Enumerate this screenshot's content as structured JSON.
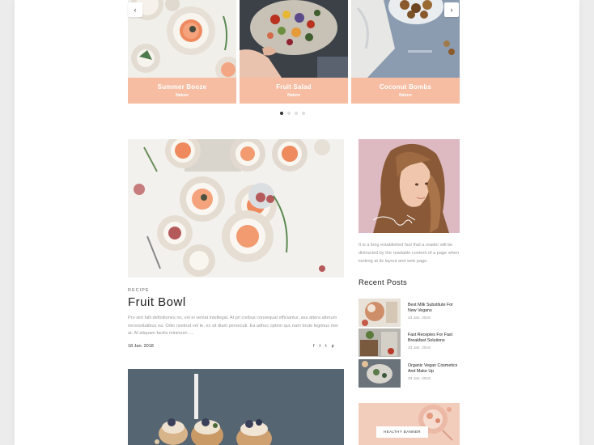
{
  "slider": {
    "slides": [
      {
        "title": "Summer Booze",
        "category": "Nature"
      },
      {
        "title": "Fruit Salad",
        "category": "Nature"
      },
      {
        "title": "Coconut Bombs",
        "category": "Nature"
      }
    ],
    "prev_icon": "chevron-left-icon",
    "next_icon": "chevron-right-icon",
    "dots": {
      "count": 4,
      "active_index": 0
    },
    "accent_color": "#f6bda2"
  },
  "article": {
    "category": "RECIPE",
    "title": "Fruit Bowl",
    "excerpt": "Pro sint falli definitiones no, vel ei veniat intellegat. At pri civibus consequat efficiantur, sea altera alterum necessitatibus ea. Odio nostrud vel te, ex sit diam persecuti. Ea adhuc option qui, nam brute legimus mei at. At aliquam facilis minimum ....",
    "date": "18 Jan. 2018",
    "share": [
      "f",
      "t",
      "t",
      "p"
    ]
  },
  "sidebar": {
    "about": "It is a long established fact that a reader will be distracted by the readable content of a page when looking at its layout and web page.",
    "recent_title": "Recent Posts",
    "posts": [
      {
        "title": "Best Milk Substitute For New Vegans",
        "date": "23 Jan. 2018"
      },
      {
        "title": "Fast Recepies For Fast Breakfast Solutions",
        "date": "23 Jan. 2018"
      },
      {
        "title": "Organic Vegan Cosmetics And Make Up",
        "date": "23 Jan. 2018"
      }
    ],
    "banner_label": "HEALTHY BANNER"
  }
}
